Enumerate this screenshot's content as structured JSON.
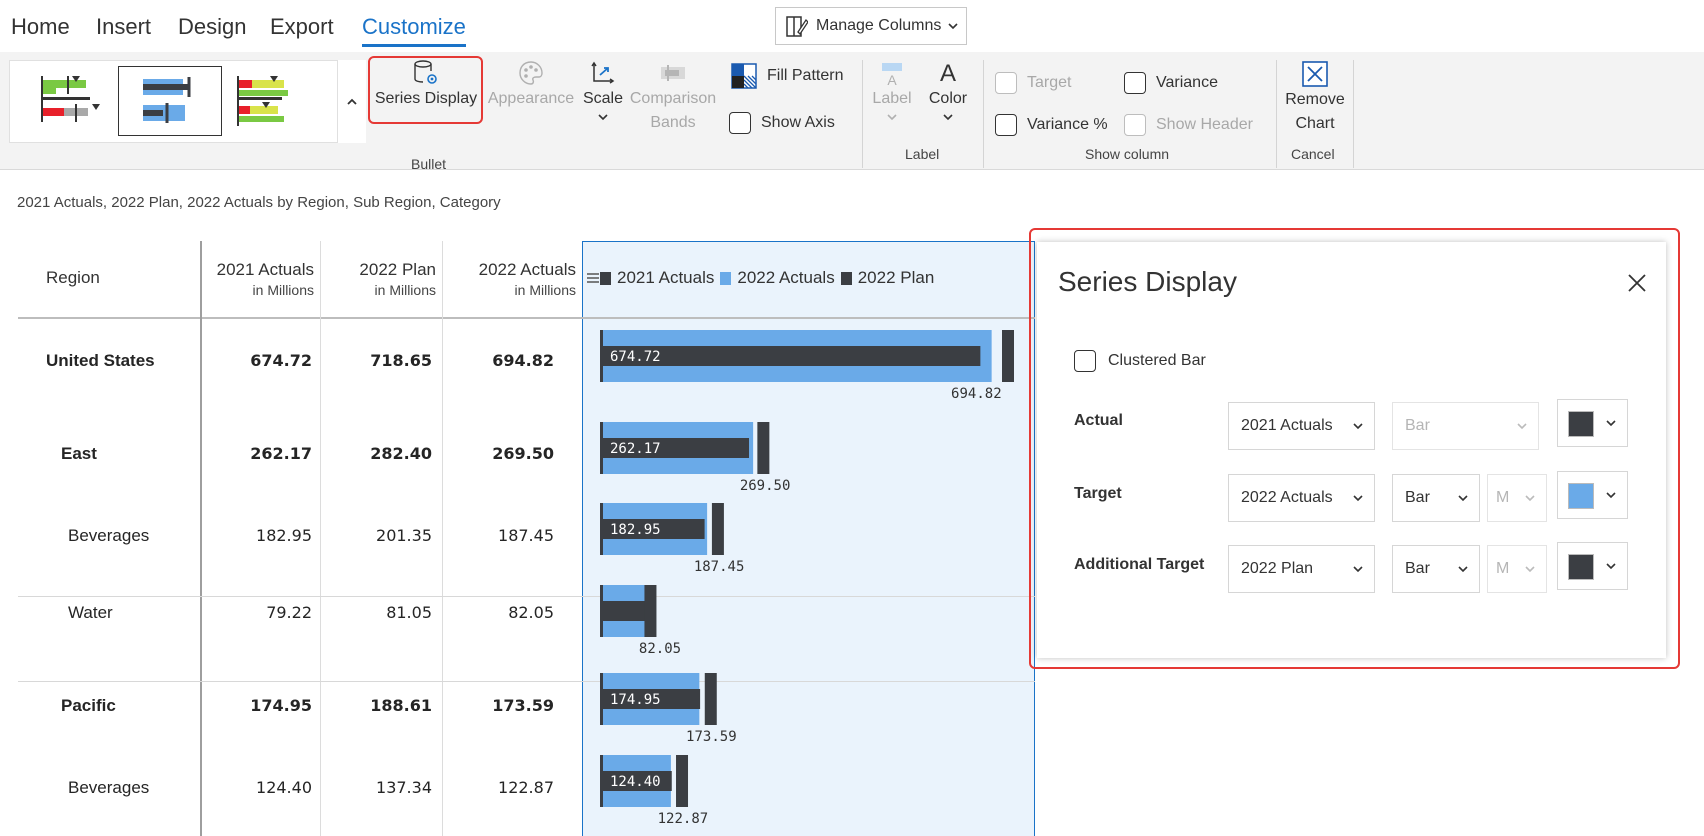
{
  "menu": {
    "tabs": [
      "Home",
      "Insert",
      "Design",
      "Export",
      "Customize"
    ],
    "active_tab": "Customize",
    "manage_columns": "Manage Columns"
  },
  "ribbon": {
    "series_display": "Series Display",
    "appearance": "Appearance",
    "scale": "Scale",
    "comparison_bands_1": "Comparison",
    "comparison_bands_2": "Bands",
    "fill_pattern": "Fill Pattern",
    "show_axis": "Show Axis",
    "bullet_group": "Bullet",
    "label": "Label",
    "color": "Color",
    "label_group": "Label",
    "target": "Target",
    "variance": "Variance",
    "variance_pct": "Variance %",
    "show_header": "Show Header",
    "show_column_group": "Show column",
    "remove_chart_1": "Remove",
    "remove_chart_2": "Chart",
    "cancel_group": "Cancel"
  },
  "subtitle": "2021 Actuals, 2022 Plan, 2022 Actuals by Region, Sub Region, Category",
  "table": {
    "headers": {
      "region": "Region",
      "col1": "2021 Actuals",
      "col2": "2022 Plan",
      "col3": "2022 Actuals",
      "unit": "in Millions"
    },
    "legend": [
      "2021 Actuals",
      "2022 Actuals",
      "2022 Plan"
    ],
    "rows": [
      {
        "label": "United States",
        "a2021": "674.72",
        "p2022": "718.65",
        "a2022": "694.82",
        "bold": true
      },
      {
        "label": "East",
        "a2021": "262.17",
        "p2022": "282.40",
        "a2022": "269.50",
        "bold": true
      },
      {
        "label": "Beverages",
        "a2021": "182.95",
        "p2022": "201.35",
        "a2022": "187.45",
        "bold": false
      },
      {
        "label": "Water",
        "a2021": "79.22",
        "p2022": "81.05",
        "a2022": "82.05",
        "bold": false
      },
      {
        "label": "Pacific",
        "a2021": "174.95",
        "p2022": "188.61",
        "a2022": "173.59",
        "bold": true
      },
      {
        "label": "Beverages",
        "a2021": "124.40",
        "p2022": "137.34",
        "a2022": "122.87",
        "bold": false
      }
    ]
  },
  "chart_data": {
    "type": "bar",
    "categories": [
      "United States",
      "East",
      "Beverages",
      "Water",
      "Pacific",
      "Beverages"
    ],
    "series": [
      {
        "name": "2021 Actuals",
        "values": [
          674.72,
          262.17,
          182.95,
          79.22,
          174.95,
          124.4
        ]
      },
      {
        "name": "2022 Actuals",
        "values": [
          694.82,
          269.5,
          187.45,
          82.05,
          173.59,
          122.87
        ]
      },
      {
        "name": "2022 Plan",
        "values": [
          718.65,
          282.4,
          201.35,
          81.05,
          188.61,
          137.34
        ]
      }
    ],
    "colors": {
      "actual": "#3b3e43",
      "target": "#6aaae8",
      "plan": "#3b3e43"
    }
  },
  "series_display": {
    "title": "Series Display",
    "clustered_bar": "Clustered Bar",
    "actual_label": "Actual",
    "actual_series": "2021 Actuals",
    "actual_type": "Bar",
    "actual_color": "#3b3e43",
    "target_label": "Target",
    "target_series": "2022 Actuals",
    "target_type": "Bar",
    "target_marker": "M",
    "target_color": "#6aaae8",
    "additional_label": "Additional Target",
    "additional_series": "2022 Plan",
    "additional_type": "Bar",
    "additional_marker": "M",
    "additional_color": "#3b3e43"
  }
}
